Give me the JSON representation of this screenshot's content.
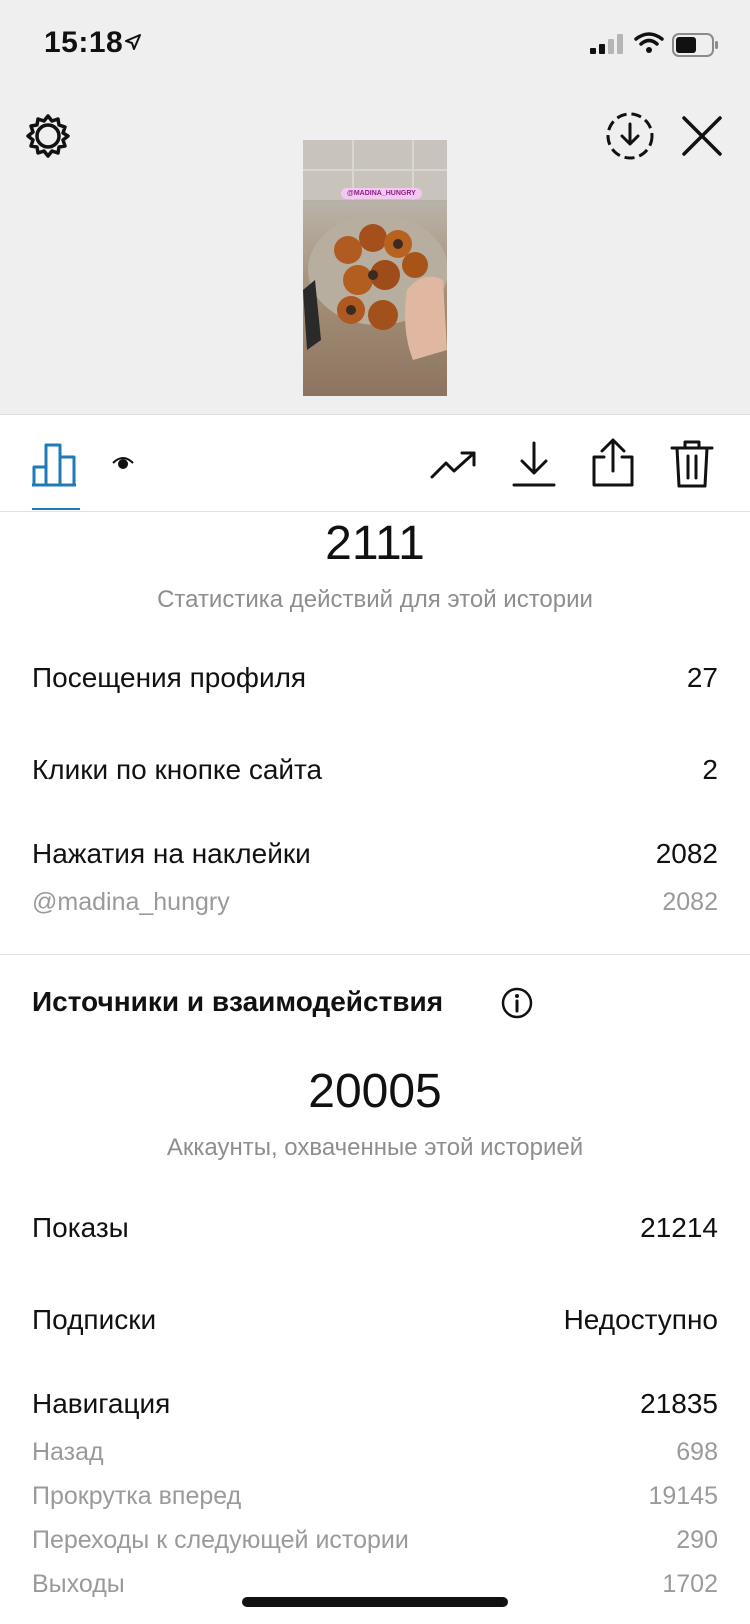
{
  "status_bar": {
    "time": "15:18"
  },
  "preview": {
    "sticker_text": "@MADINA_HUNGRY"
  },
  "stats": {
    "big_number": "2111",
    "caption": "Статистика действий для этой истории",
    "rows": [
      {
        "label": "Посещения профиля",
        "value": "27"
      },
      {
        "label": "Клики по кнопке сайта",
        "value": "2"
      },
      {
        "label": "Нажатия на наклейки",
        "value": "2082"
      }
    ],
    "sticker_detail": {
      "label": "@madina_hungry",
      "value": "2082"
    }
  },
  "sources": {
    "title": "Источники и взаимодействия",
    "big_number": "20005",
    "caption": "Аккаунты, охваченные этой историей",
    "rows": [
      {
        "label": "Показы",
        "value": "21214"
      },
      {
        "label": "Подписки",
        "value": "Недоступно"
      },
      {
        "label": "Навигация",
        "value": "21835"
      }
    ],
    "navigation_details": [
      {
        "label": "Назад",
        "value": "698"
      },
      {
        "label": "Прокрутка вперед",
        "value": "19145"
      },
      {
        "label": "Переходы к следующей истории",
        "value": "290"
      },
      {
        "label": "Выходы",
        "value": "1702"
      }
    ]
  },
  "colors": {
    "accent": "#1f7ab8",
    "secondary_text": "#8e8e8e"
  },
  "icons": [
    "location-arrow-icon",
    "signal-icon",
    "wifi-icon",
    "battery-icon",
    "settings-gear-icon",
    "download-circle-icon",
    "close-icon",
    "bar-chart-icon",
    "eye-icon",
    "trend-icon",
    "download-icon",
    "share-icon",
    "trash-icon",
    "info-icon"
  ]
}
